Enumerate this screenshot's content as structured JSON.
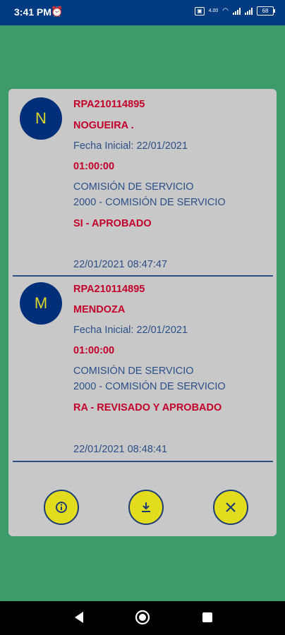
{
  "status_bar": {
    "time": "3:41 PM",
    "alarm_icon": "alarm-clock-icon",
    "wifi_label": "4.00",
    "battery_level": "68"
  },
  "cards": [
    {
      "avatar_letter": "N",
      "code": "RPA210114895",
      "name": "NOGUEIRA .",
      "start_date": "Fecha Inicial: 22/01/2021",
      "duration": "01:00:00",
      "type_line1": "COMISIÓN DE SERVICIO",
      "type_line2": "2000 - COMISIÓN DE SERVICIO",
      "status": "SI - APROBADO",
      "timestamp": "22/01/2021 08:47:47"
    },
    {
      "avatar_letter": "M",
      "code": "RPA210114895",
      "name": "MENDOZA",
      "start_date": "Fecha Inicial: 22/01/2021",
      "duration": "01:00:00",
      "type_line1": "COMISIÓN DE SERVICIO",
      "type_line2": "2000 - COMISIÓN DE SERVICIO",
      "status": "RA - REVISADO Y APROBADO",
      "timestamp": "22/01/2021 08:48:41"
    }
  ],
  "actions": [
    {
      "icon": "info-icon"
    },
    {
      "icon": "download-icon"
    },
    {
      "icon": "close-icon"
    }
  ],
  "colors": {
    "background": "#3c9a6b",
    "panel": "#c8c8c8",
    "avatar": "#002f7a",
    "accent_red": "#c2002b",
    "text_blue": "#2b4f86",
    "button_yellow": "#e1dc1e"
  }
}
